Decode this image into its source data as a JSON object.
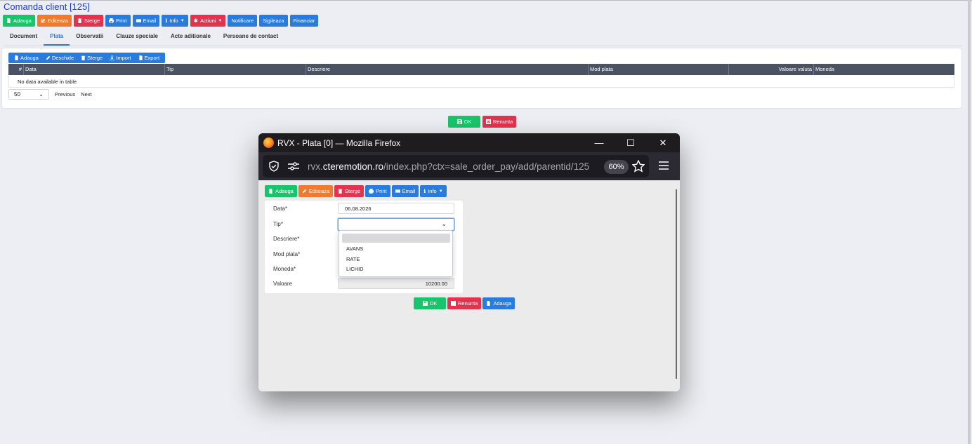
{
  "page": {
    "title": "Comanda client [125]",
    "toolbar": {
      "add": "Adauga",
      "edit": "Editeaza",
      "delete": "Sterge",
      "print": "Print",
      "email": "Email",
      "info": "Info",
      "actions": "Actiuni",
      "notify": "Notificare",
      "seal": "Sigileaza",
      "financial": "Financiar"
    },
    "tabs": [
      "Document",
      "Plata",
      "Observatii",
      "Clauze speciale",
      "Acte aditionale",
      "Persoane de contact"
    ],
    "active_tab": "Plata",
    "subtoolbar": {
      "add": "Adauga",
      "open": "Deschide",
      "delete": "Sterge",
      "import": "Import",
      "export": "Export"
    },
    "table": {
      "columns": [
        "#",
        "Data",
        "Tip",
        "Descriere",
        "Mod plata",
        "Valoare valuta",
        "Moneda"
      ],
      "empty_text": "No data available in table"
    },
    "pager": {
      "page_size": "50",
      "previous": "Previous",
      "next": "Next"
    },
    "footer": {
      "ok": "OK",
      "cancel": "Renunta"
    }
  },
  "popup": {
    "window_title": "RVX - Plata [0] — Mozilla Firefox",
    "url_prefix": "rvx.",
    "url_domain": "cteremotion.ro",
    "url_path": "/index.php?ctx=sale_order_pay/add/parentid/125",
    "zoom": "60%",
    "toolbar": {
      "add": "Adauga",
      "edit": "Editeaza",
      "delete": "Sterge",
      "print": "Print",
      "email": "Email",
      "info": "Info"
    },
    "form": {
      "date_label": "Data*",
      "date_value": "06.08.2026",
      "type_label": "Tip*",
      "type_value": "",
      "desc_label": "Descriere*",
      "pay_mode_label": "Mod plata*",
      "currency_label": "Moneda*",
      "value_label": "Valoare",
      "value_value": "10200.00"
    },
    "type_options": [
      "",
      "AVANS",
      "RATE",
      "LICHID"
    ],
    "footer": {
      "ok": "OK",
      "cancel": "Renunta",
      "add": "Adauga"
    }
  },
  "colors": {
    "green": "#19c56b",
    "orange": "#f07a2e",
    "red": "#e3344f",
    "blue": "#2a7bde",
    "title": "#1a3fd1",
    "table_header": "#4b5263"
  }
}
